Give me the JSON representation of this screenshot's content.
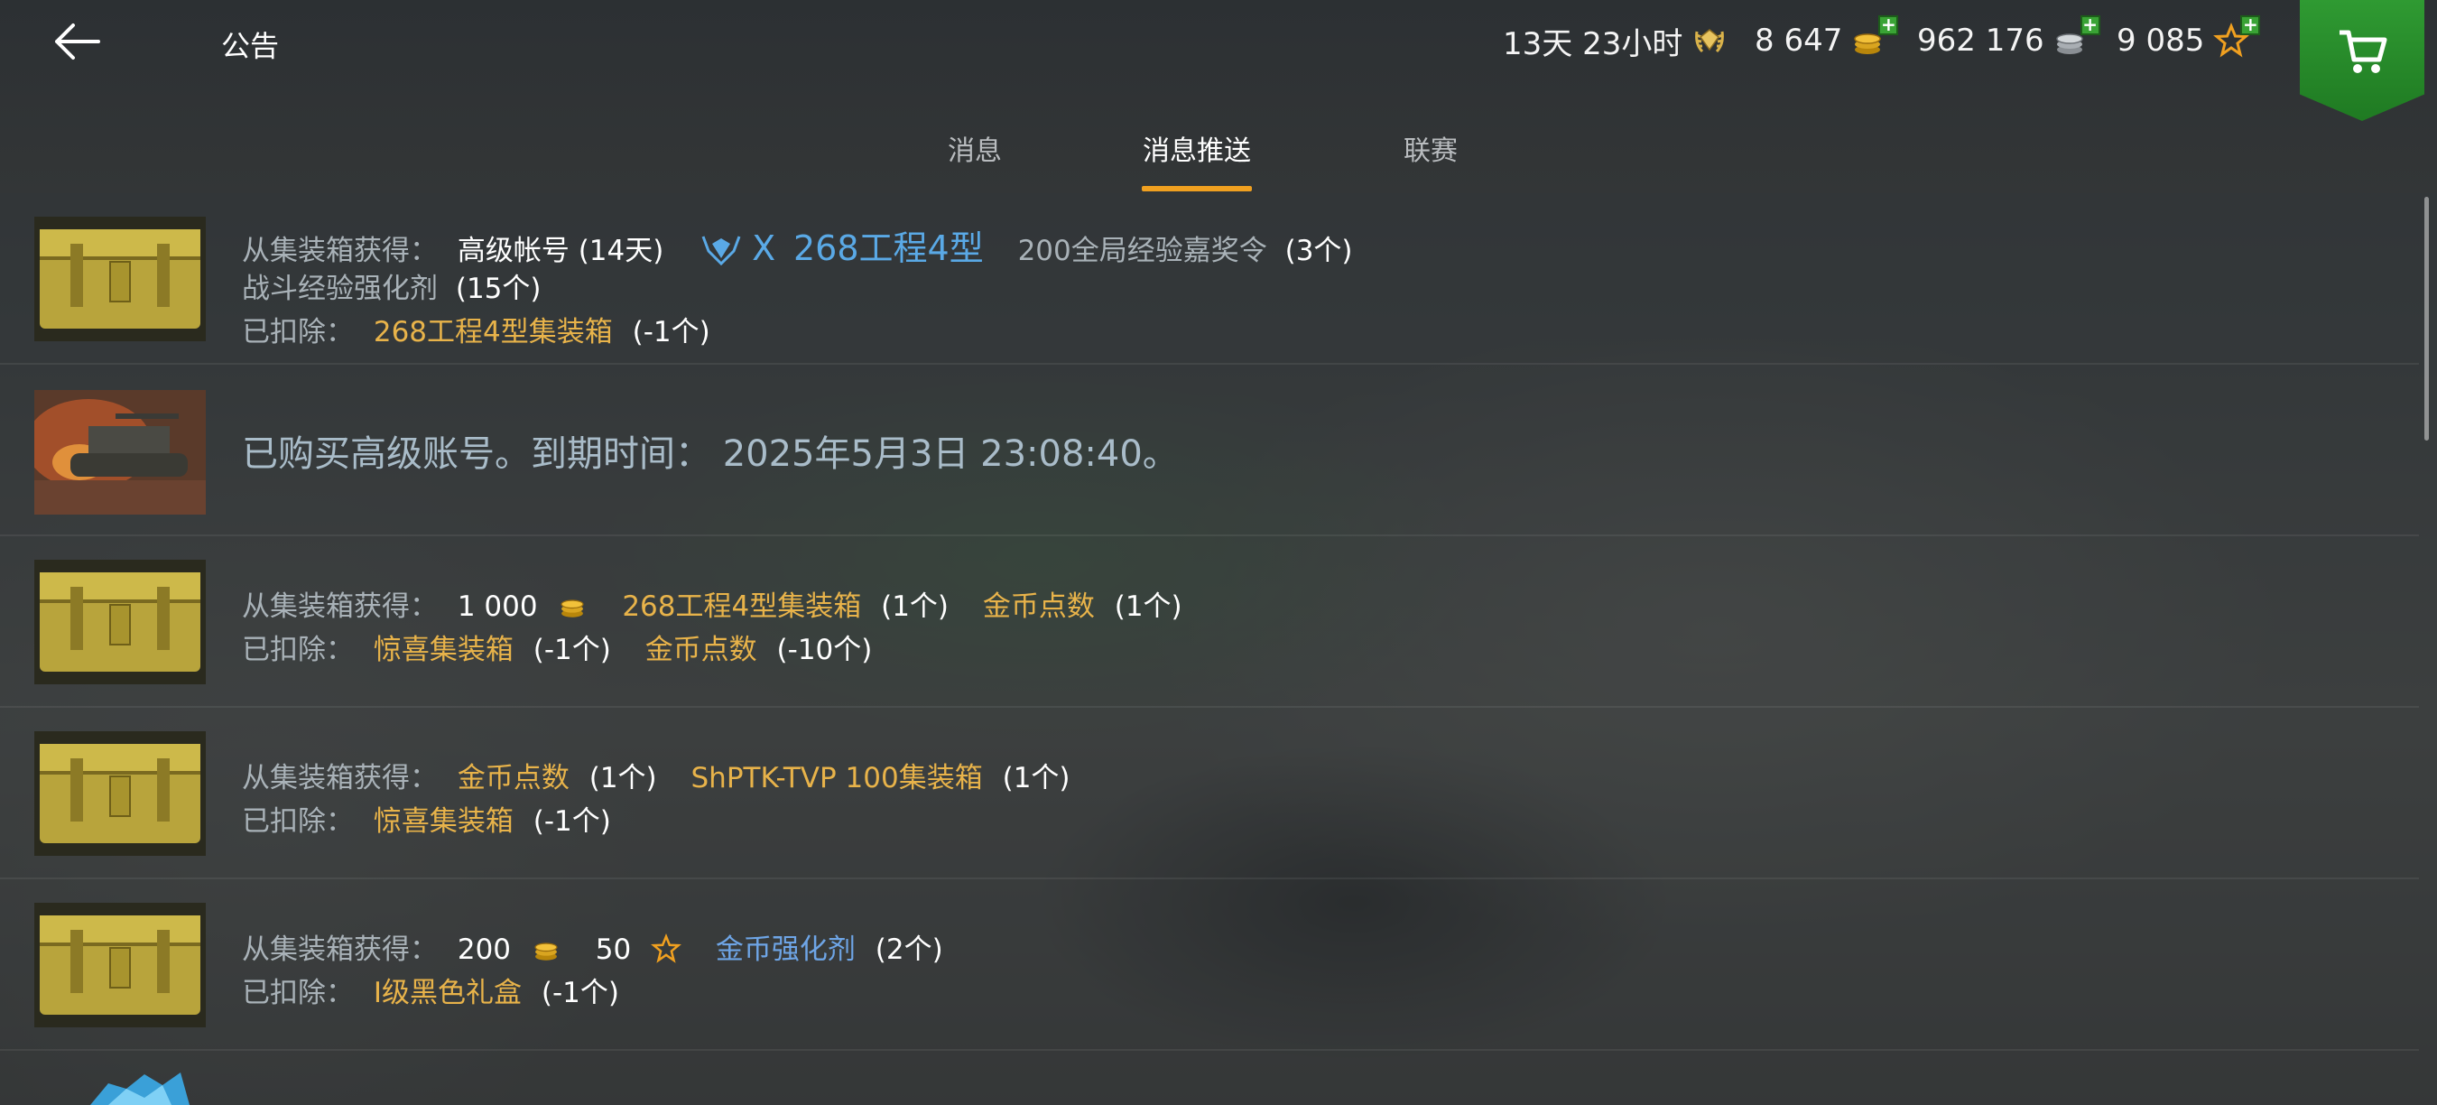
{
  "header": {
    "title": "公告",
    "premium_time": "13天 23小时",
    "gold": "8 647",
    "silver": "962 176",
    "free_xp": "9 085"
  },
  "tabs": [
    {
      "label": "消息",
      "active": false
    },
    {
      "label": "消息推送",
      "active": true
    },
    {
      "label": "联赛",
      "active": false
    }
  ],
  "messages": [
    {
      "type": "container",
      "received_label": "从集装箱获得：",
      "item1": "高级帐号 (14天)",
      "tank_tier": "X",
      "tank_name": "268工程4型",
      "item2": "200全局经验嘉奖令",
      "item2_count": "(3个)",
      "item3": "战斗经验强化剂",
      "item3_count": "(15个)",
      "deducted_label": "已扣除：",
      "deducted_item": "268工程4型集装箱",
      "deducted_count": "(-1个)"
    },
    {
      "type": "purchase",
      "text": "已购买高级账号。到期时间：  2025年5月3日 23:08:40。"
    },
    {
      "type": "container",
      "received_label": "从集装箱获得：",
      "gold_amount": "1 000",
      "item1": "268工程4型集装箱",
      "item1_count": "(1个)",
      "item2": "金币点数",
      "item2_count": "(1个)",
      "deducted_label": "已扣除：",
      "deducted_item1": "惊喜集装箱",
      "deducted_count1": "(-1个)",
      "deducted_item2": "金币点数",
      "deducted_count2": "(-10个)"
    },
    {
      "type": "container",
      "received_label": "从集装箱获得：",
      "item1": "金币点数",
      "item1_count": "(1个)",
      "item2": "ShPTK-TVP 100集装箱",
      "item2_count": "(1个)",
      "deducted_label": "已扣除：",
      "deducted_item": "惊喜集装箱",
      "deducted_count": "(-1个)"
    },
    {
      "type": "container",
      "received_label": "从集装箱获得：",
      "gold_amount": "200",
      "xp_amount": "50",
      "item1": "金币强化剂",
      "item1_count": "(2个)",
      "deducted_label": "已扣除：",
      "deducted_item": "I级黑色礼盒",
      "deducted_count": "(-1个)"
    }
  ],
  "colors": {
    "accent_tab": "#f0a020",
    "item_gold": "#e8b34a",
    "item_blue": "#6ea5e6",
    "shop_green": "#2f9a32"
  },
  "icons": [
    "back-arrow-icon",
    "premium-icon",
    "gold-coins-icon",
    "silver-coins-icon",
    "free-xp-star-icon",
    "shopping-cart-icon"
  ]
}
